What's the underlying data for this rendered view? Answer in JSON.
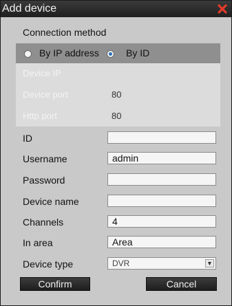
{
  "dialog": {
    "title": "Add device",
    "close_icon": "close-x-icon"
  },
  "connection": {
    "label": "Connection method",
    "options": [
      {
        "label": "By IP address",
        "selected": false
      },
      {
        "label": "By ID",
        "selected": true
      }
    ],
    "disabled_fields": [
      {
        "label": "Device IP",
        "value": ""
      },
      {
        "label": "Device port",
        "value": "80"
      },
      {
        "label": "Http port",
        "value": "80"
      }
    ]
  },
  "fields": {
    "id": {
      "label": "ID",
      "value": ""
    },
    "username": {
      "label": "Username",
      "value": "admin"
    },
    "password": {
      "label": "Password",
      "value": ""
    },
    "device_name": {
      "label": "Device name",
      "value": ""
    },
    "channels": {
      "label": "Channels",
      "value": "4"
    },
    "in_area": {
      "label": "In area",
      "value": "Area"
    },
    "device_type": {
      "label": "Device type",
      "value": "DVR"
    }
  },
  "buttons": {
    "confirm": "Confirm",
    "cancel": "Cancel"
  },
  "colors": {
    "titlebar": "#2a2a2a",
    "dialog_bg": "#c9c9c9",
    "radio_bar": "#8f8f8f",
    "close_icon": "#e23b2a",
    "radio_selected": "#2a6fb8"
  }
}
